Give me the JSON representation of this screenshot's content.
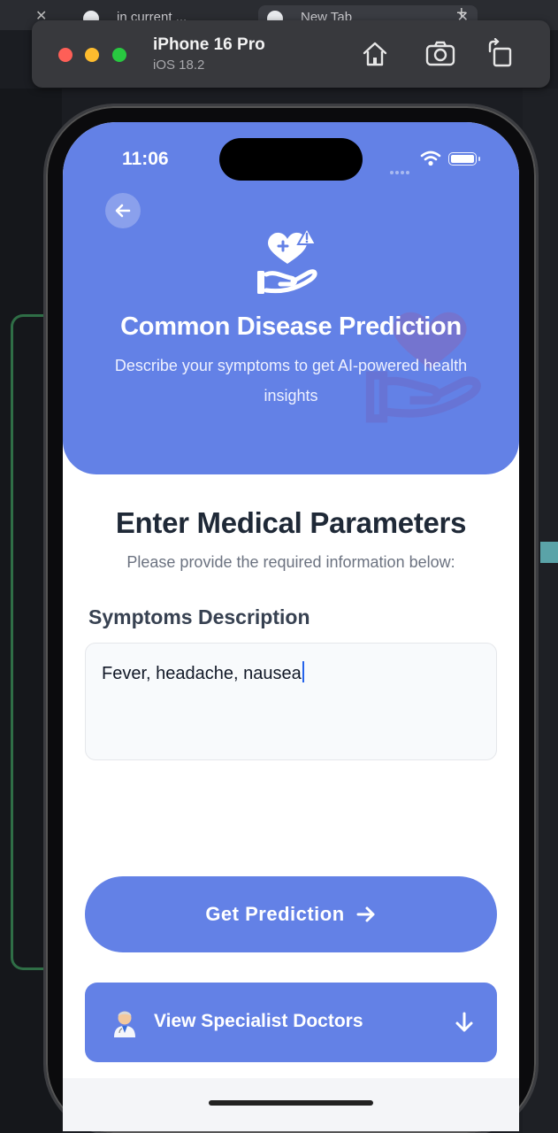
{
  "browser": {
    "tabs": [
      {
        "label": "in current ..."
      },
      {
        "label": "New Tab"
      }
    ]
  },
  "simulator": {
    "device_name": "iPhone 16 Pro",
    "os_version": "iOS 18.2",
    "toolbar_icons": [
      "home-icon",
      "screenshot-icon",
      "rotate-icon"
    ]
  },
  "status_bar": {
    "time": "11:06"
  },
  "header": {
    "back_icon": "arrow-left-icon",
    "hero_icon": "heart-hand-warning-icon",
    "title": "Common Disease Prediction",
    "subtitle": "Describe your symptoms to get AI-powered health insights"
  },
  "form": {
    "title": "Enter Medical Parameters",
    "subtitle": "Please provide the required information below:",
    "symptoms_label": "Symptoms Description",
    "symptoms_value": "Fever, headache, nausea"
  },
  "actions": {
    "predict_label": "Get Prediction",
    "predict_icon": "arrow-right-icon",
    "doctors_label": "View Specialist Doctors",
    "doctors_icon": "doctor-emoji",
    "doctors_trailing_icon": "arrow-down-icon"
  },
  "colors": {
    "primary": "#6381e6",
    "heading": "#1f2937",
    "muted": "#6b7280"
  }
}
